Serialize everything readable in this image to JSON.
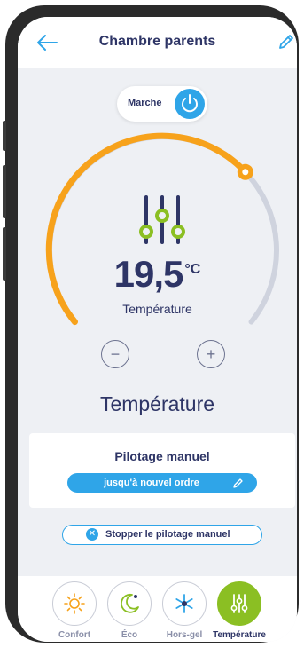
{
  "header": {
    "title": "Chambre parents"
  },
  "power": {
    "label": "Marche"
  },
  "thermostat": {
    "value": "19,5",
    "unit": "°C",
    "label": "Température",
    "minus": "−",
    "plus": "+",
    "setpoint_fraction": 0.68
  },
  "mode": {
    "title": "Température"
  },
  "manual": {
    "title": "Pilotage manuel",
    "until_label": "jusqu'à nouvel ordre",
    "stop_label": "Stopper le pilotage manuel"
  },
  "nav": {
    "items": [
      {
        "label": "Confort",
        "icon": "sun-icon"
      },
      {
        "label": "Éco",
        "icon": "moon-icon"
      },
      {
        "label": "Hors-gel",
        "icon": "snowflake-icon"
      },
      {
        "label": "Température",
        "icon": "sliders-icon",
        "active": true
      }
    ]
  },
  "colors": {
    "primary": "#2fa5e8",
    "accent_orange": "#f7a21b",
    "active_green": "#8bbf23",
    "text_dark": "#2e3566"
  }
}
